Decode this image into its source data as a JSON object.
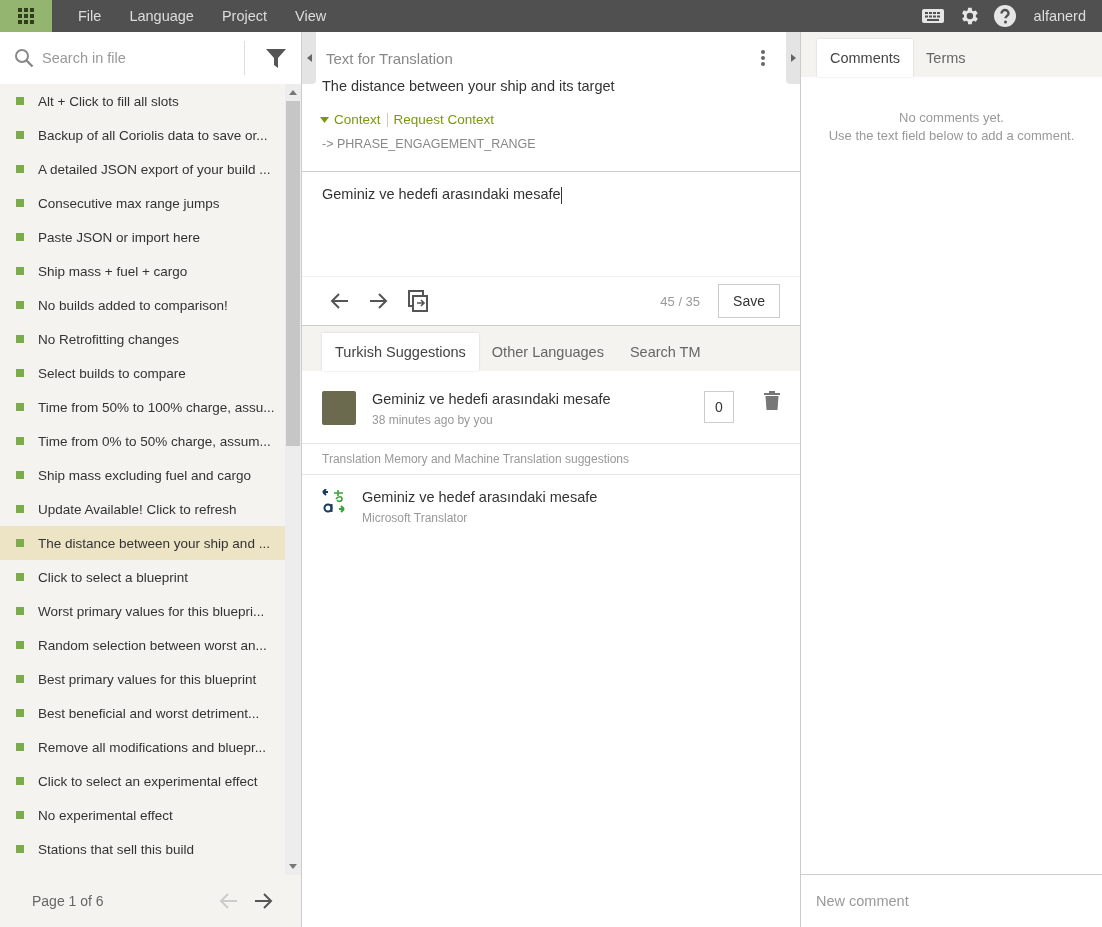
{
  "menu": [
    "File",
    "Language",
    "Project",
    "View"
  ],
  "user": "alfanerd",
  "sidebar": {
    "search": {
      "placeholder": "Search in file"
    },
    "items": [
      {
        "label": "Alt + Click to fill all slots",
        "selected": false
      },
      {
        "label": "Backup of all Coriolis data to save or...",
        "selected": false
      },
      {
        "label": "A detailed JSON export of your build ...",
        "selected": false
      },
      {
        "label": "Consecutive max range jumps",
        "selected": false
      },
      {
        "label": "Paste JSON or import here",
        "selected": false
      },
      {
        "label": "Ship mass + fuel + cargo",
        "selected": false
      },
      {
        "label": "No builds added to comparison!",
        "selected": false
      },
      {
        "label": "No Retrofitting changes",
        "selected": false
      },
      {
        "label": "Select builds to compare",
        "selected": false
      },
      {
        "label": "Time from 50% to 100% charge, assu...",
        "selected": false
      },
      {
        "label": "Time from 0% to 50% charge, assum...",
        "selected": false
      },
      {
        "label": "Ship mass excluding fuel and cargo",
        "selected": false
      },
      {
        "label": "Update Available! Click to refresh",
        "selected": false
      },
      {
        "label": "The distance between your ship and ...",
        "selected": true
      },
      {
        "label": "Click to select a blueprint",
        "selected": false
      },
      {
        "label": "Worst primary values for this bluepri...",
        "selected": false
      },
      {
        "label": "Random selection between worst an...",
        "selected": false
      },
      {
        "label": "Best primary values for this blueprint",
        "selected": false
      },
      {
        "label": "Best beneficial and worst detriment...",
        "selected": false
      },
      {
        "label": "Remove all modifications and bluepr...",
        "selected": false
      },
      {
        "label": "Click to select an experimental effect",
        "selected": false
      },
      {
        "label": "No experimental effect",
        "selected": false
      },
      {
        "label": "Stations that sell this build",
        "selected": false
      }
    ],
    "pager": "Page 1 of 6"
  },
  "editor": {
    "title": "Text for Translation",
    "source": "The distance between your ship and its target",
    "context": {
      "label": "Context",
      "expanded": true,
      "request": "Request Context",
      "key": "-> PHRASE_ENGAGEMENT_RANGE"
    },
    "translation": "Geminiz ve hedefi arasındaki mesafe",
    "count": "45 / 35",
    "save": "Save"
  },
  "suggestions": {
    "tabs": [
      {
        "label": "Turkish Suggestions",
        "selected": true
      },
      {
        "label": "Other Languages",
        "selected": false
      },
      {
        "label": "Search TM",
        "selected": false
      }
    ],
    "own": {
      "text": "Geminiz ve hedefi arasındaki mesafe",
      "meta": "38 minutes ago by you",
      "votes": "0"
    },
    "section": "Translation Memory and Machine Translation suggestions",
    "machine": {
      "text": "Geminiz ve hedef arasındaki mesafe",
      "meta": "Microsoft Translator"
    }
  },
  "comments": {
    "tabs": [
      {
        "label": "Comments",
        "selected": true
      },
      {
        "label": "Terms",
        "selected": false
      }
    ],
    "empty": [
      "No comments yet.",
      "Use the text field below to add a comment."
    ],
    "new": {
      "placeholder": "New comment"
    }
  }
}
